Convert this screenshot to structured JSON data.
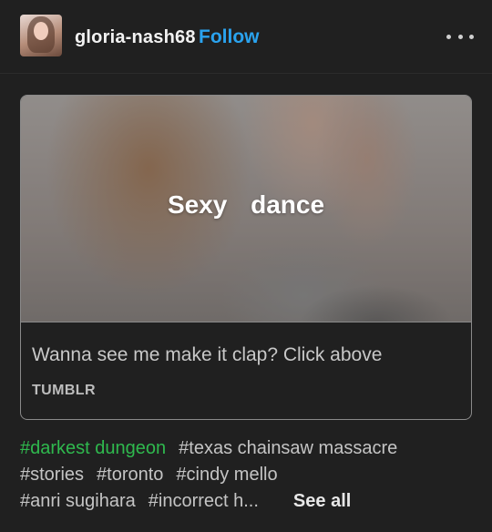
{
  "post": {
    "username": "gloria-nash68",
    "follow_label": "Follow",
    "more_icon": "more-dots-icon"
  },
  "link_card": {
    "thumbnail_title": "Sexy dance",
    "description": "Wanna see me make it clap? Click above",
    "source": "TUMBLR"
  },
  "tags": [
    {
      "text": "#darkest dungeon",
      "highlighted": true
    },
    {
      "text": "#texas chainsaw massacre"
    },
    {
      "text": "#stories"
    },
    {
      "text": "#toronto"
    },
    {
      "text": "#cindy mello"
    },
    {
      "text": "#anri sugihara"
    },
    {
      "text": "#incorrect h..."
    }
  ],
  "see_all_label": "See all",
  "colors": {
    "background": "#202020",
    "follow_blue": "#2aa3ef",
    "highlight_tag_green": "#2fb94e"
  }
}
